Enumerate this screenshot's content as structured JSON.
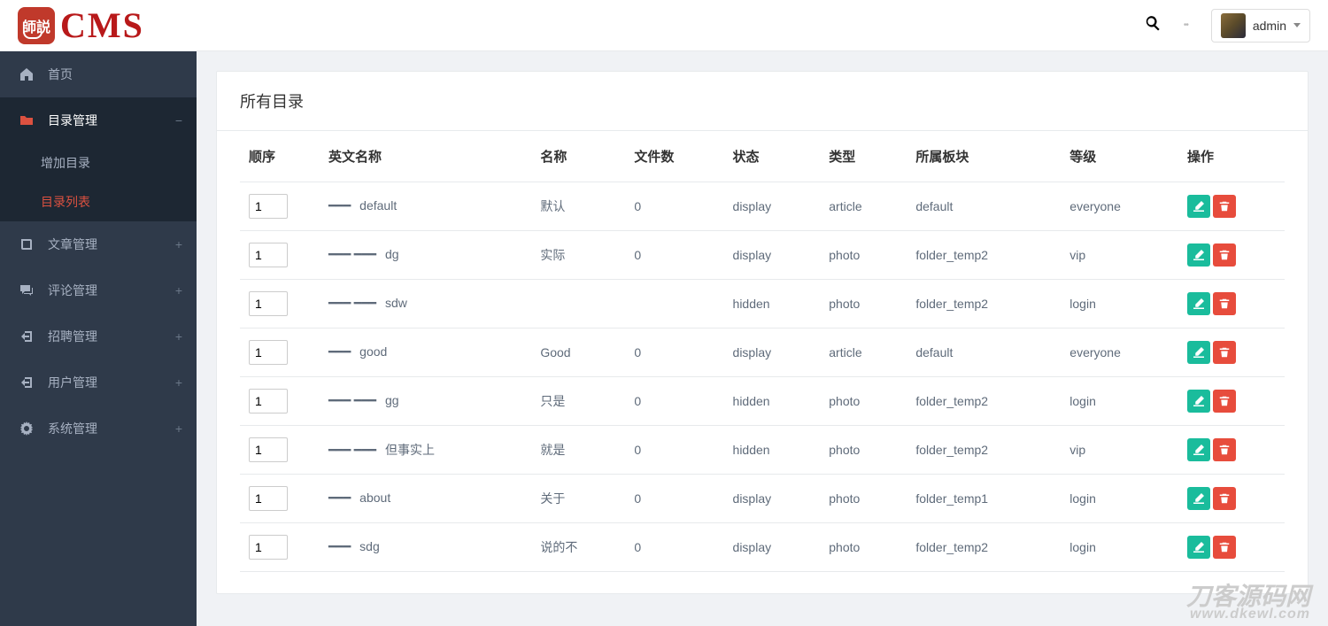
{
  "brand": {
    "badge": "師説",
    "name": "CMS"
  },
  "user": {
    "name": "admin"
  },
  "sidebar": {
    "items": [
      {
        "label": "首页",
        "icon": "home",
        "active": false,
        "expandable": false
      },
      {
        "label": "目录管理",
        "icon": "folder",
        "active": true,
        "expandable": true,
        "expanded": true,
        "children": [
          {
            "label": "增加目录",
            "current": false
          },
          {
            "label": "目录列表",
            "current": true
          }
        ]
      },
      {
        "label": "文章管理",
        "icon": "book",
        "active": false,
        "expandable": true
      },
      {
        "label": "评论管理",
        "icon": "comments",
        "active": false,
        "expandable": true
      },
      {
        "label": "招聘管理",
        "icon": "signin",
        "active": false,
        "expandable": true
      },
      {
        "label": "用户管理",
        "icon": "signin",
        "active": false,
        "expandable": true
      },
      {
        "label": "系统管理",
        "icon": "cogs",
        "active": false,
        "expandable": true
      }
    ]
  },
  "page": {
    "title": "所有目录",
    "columns": [
      "顺序",
      "英文名称",
      "名称",
      "文件数",
      "状态",
      "类型",
      "所属板块",
      "等级",
      "操作"
    ],
    "rows": [
      {
        "order": "1",
        "indent": 1,
        "ename": "default",
        "name": "默认",
        "files": "0",
        "status": "display",
        "type": "article",
        "module": "default",
        "level": "everyone"
      },
      {
        "order": "1",
        "indent": 2,
        "ename": "dg",
        "name": "实际",
        "files": "0",
        "status": "display",
        "type": "photo",
        "module": "folder_temp2",
        "level": "vip"
      },
      {
        "order": "1",
        "indent": 2,
        "ename": "sdw",
        "name": "",
        "files": "",
        "status": "hidden",
        "type": "photo",
        "module": "folder_temp2",
        "level": "login"
      },
      {
        "order": "1",
        "indent": 1,
        "ename": "good",
        "name": "Good",
        "files": "0",
        "status": "display",
        "type": "article",
        "module": "default",
        "level": "everyone"
      },
      {
        "order": "1",
        "indent": 2,
        "ename": "gg",
        "name": "只是",
        "files": "0",
        "status": "hidden",
        "type": "photo",
        "module": "folder_temp2",
        "level": "login"
      },
      {
        "order": "1",
        "indent": 2,
        "ename": "但事实上",
        "name": "就是",
        "files": "0",
        "status": "hidden",
        "type": "photo",
        "module": "folder_temp2",
        "level": "vip"
      },
      {
        "order": "1",
        "indent": 1,
        "ename": "about",
        "name": "关于",
        "files": "0",
        "status": "display",
        "type": "photo",
        "module": "folder_temp1",
        "level": "login"
      },
      {
        "order": "1",
        "indent": 1,
        "ename": "sdg",
        "name": "说的不",
        "files": "0",
        "status": "display",
        "type": "photo",
        "module": "folder_temp2",
        "level": "login"
      }
    ]
  },
  "watermark": {
    "line1": "刀客源码网",
    "line2": "www.dkewl.com"
  }
}
